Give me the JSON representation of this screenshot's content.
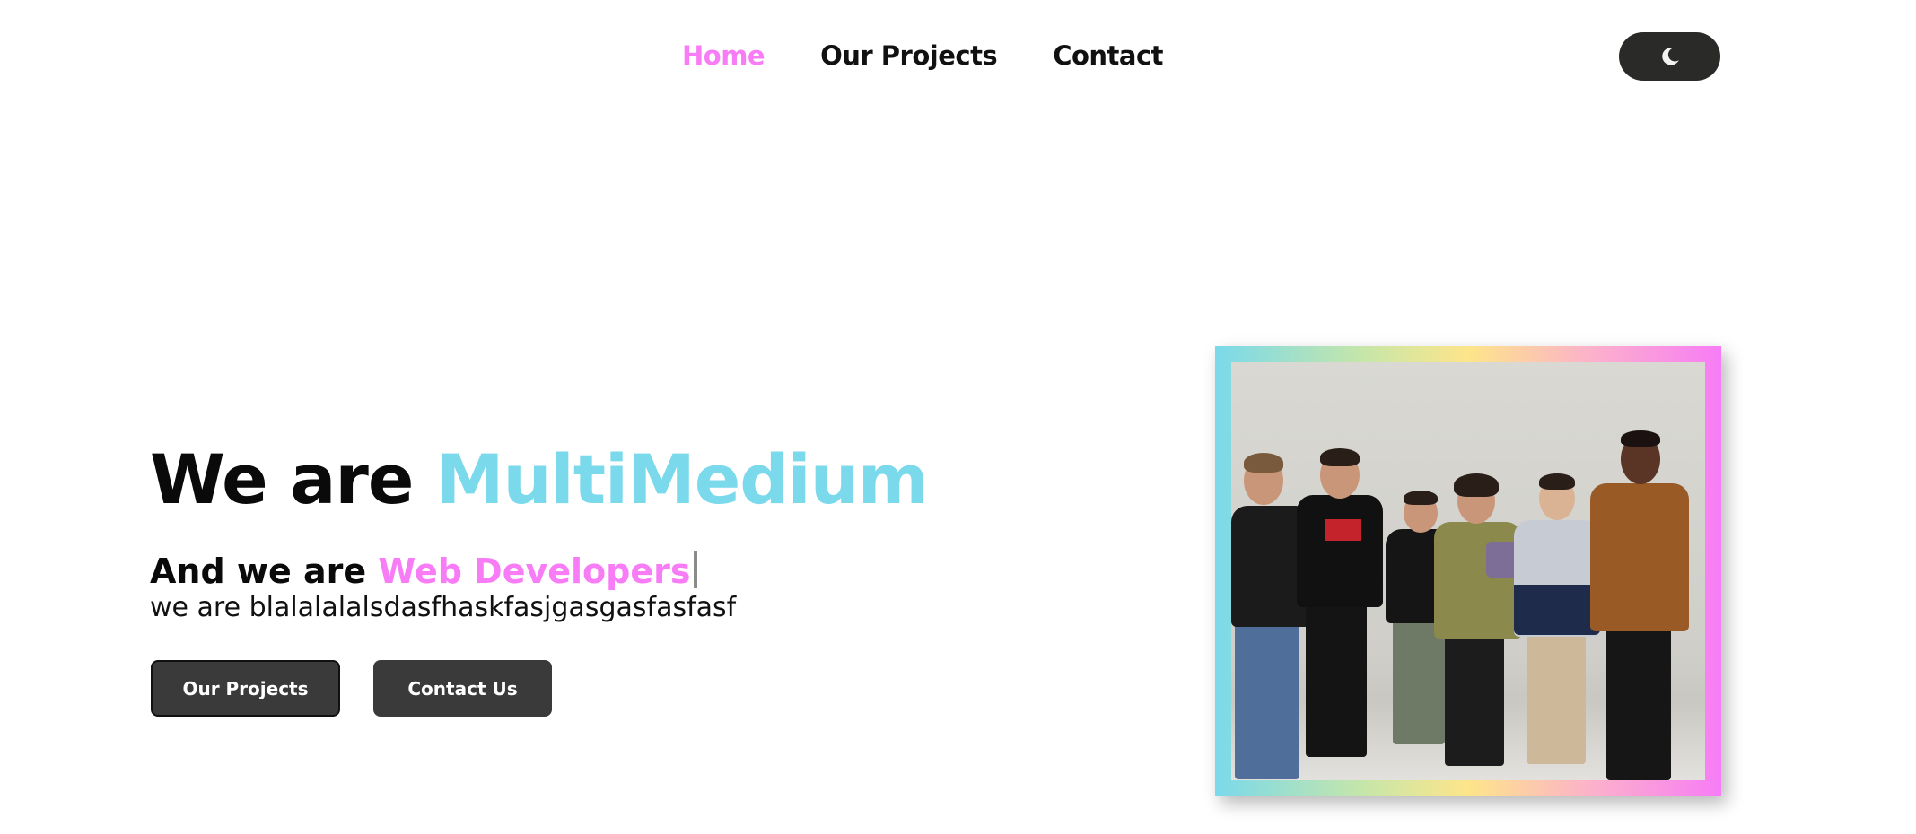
{
  "nav": {
    "links": [
      {
        "label": "Home",
        "active": true
      },
      {
        "label": "Our Projects",
        "active": false
      },
      {
        "label": "Contact",
        "active": false
      }
    ],
    "theme_toggle_icon": "moon-icon"
  },
  "hero": {
    "title_prefix": "We are",
    "title_brand": "MultiMedium",
    "subtitle_prefix": "And we are",
    "subtitle_role": "Web Developers",
    "description": "we are blalalalalsdasfhaskfasjgasgasfasfasf",
    "buttons": {
      "projects": "Our Projects",
      "contact": "Contact Us"
    }
  },
  "photo": {
    "subject": "group-photo"
  },
  "colors": {
    "accent_pink": "#f77cf6",
    "accent_cyan": "#7ad9eb",
    "button_bg": "#3a3a3a",
    "toggle_bg": "#2a2a28"
  }
}
